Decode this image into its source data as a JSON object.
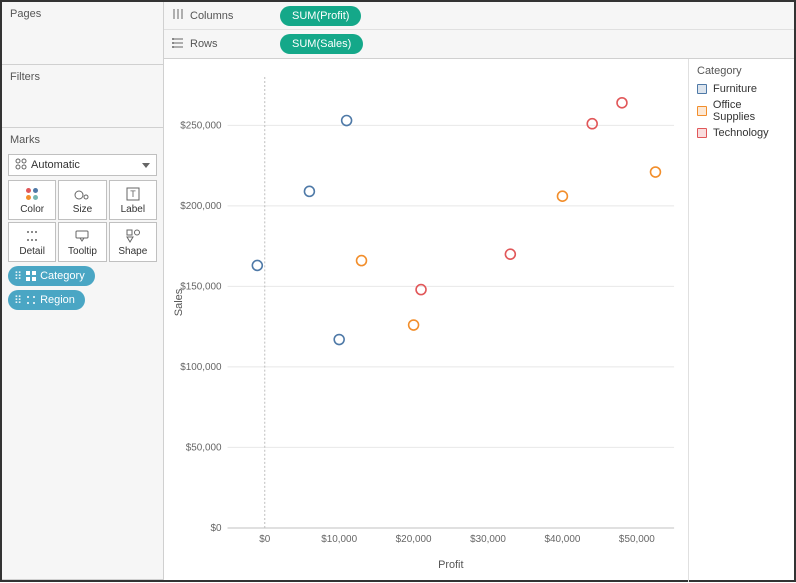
{
  "sidebar": {
    "pages_title": "Pages",
    "filters_title": "Filters",
    "marks_title": "Marks",
    "marks_dropdown": "Automatic",
    "mark_buttons": [
      {
        "label": "Color",
        "icon": "color"
      },
      {
        "label": "Size",
        "icon": "size"
      },
      {
        "label": "Label",
        "icon": "label"
      },
      {
        "label": "Detail",
        "icon": "detail"
      },
      {
        "label": "Tooltip",
        "icon": "tooltip"
      },
      {
        "label": "Shape",
        "icon": "shape"
      }
    ],
    "pills": [
      {
        "label": "Category",
        "icon": "color"
      },
      {
        "label": "Region",
        "icon": "detail"
      }
    ]
  },
  "shelves": {
    "columns_label": "Columns",
    "rows_label": "Rows",
    "columns_pill": "SUM(Profit)",
    "rows_pill": "SUM(Sales)"
  },
  "legend": {
    "title": "Category",
    "items": [
      {
        "label": "Furniture",
        "color": "#4e79a7"
      },
      {
        "label": "Office Supplies",
        "color": "#f28e2b"
      },
      {
        "label": "Technology",
        "color": "#e15759"
      }
    ]
  },
  "chart_data": {
    "type": "scatter",
    "xlabel": "Profit",
    "ylabel": "Sales",
    "xlim": [
      -5000,
      55000
    ],
    "ylim": [
      0,
      280000
    ],
    "x_ticks": [
      0,
      10000,
      20000,
      30000,
      40000,
      50000
    ],
    "y_ticks": [
      0,
      50000,
      100000,
      150000,
      200000,
      250000
    ],
    "x_tick_labels": [
      "$0",
      "$10,000",
      "$20,000",
      "$30,000",
      "$40,000",
      "$50,000"
    ],
    "y_tick_labels": [
      "$0",
      "$50,000",
      "$100,000",
      "$150,000",
      "$200,000",
      "$250,000"
    ],
    "series": [
      {
        "name": "Furniture",
        "color": "#4e79a7",
        "points": [
          {
            "x": -1000,
            "y": 163000
          },
          {
            "x": 6000,
            "y": 209000
          },
          {
            "x": 11000,
            "y": 253000
          },
          {
            "x": 10000,
            "y": 117000
          }
        ]
      },
      {
        "name": "Office Supplies",
        "color": "#f28e2b",
        "points": [
          {
            "x": 13000,
            "y": 166000
          },
          {
            "x": 20000,
            "y": 126000
          },
          {
            "x": 40000,
            "y": 206000
          },
          {
            "x": 52500,
            "y": 221000
          }
        ]
      },
      {
        "name": "Technology",
        "color": "#e15759",
        "points": [
          {
            "x": 21000,
            "y": 148000
          },
          {
            "x": 33000,
            "y": 170000
          },
          {
            "x": 44000,
            "y": 251000
          },
          {
            "x": 48000,
            "y": 264000
          }
        ]
      }
    ]
  }
}
